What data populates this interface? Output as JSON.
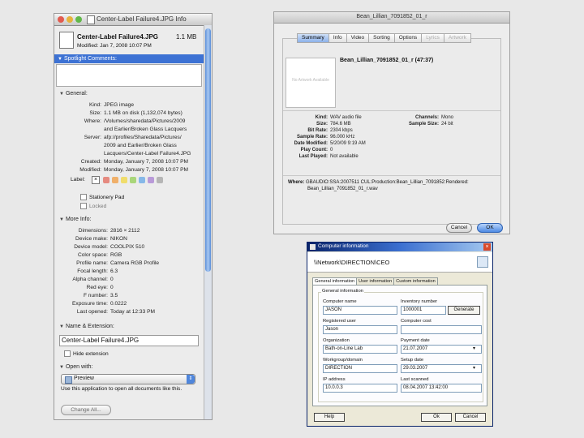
{
  "info_window": {
    "title": "Center-Label Failure4.JPG Info",
    "file_name": "Center-Label Failure4.JPG",
    "file_size": "1.1 MB",
    "modified_line": "Modified: Jan 7, 2008 10:07 PM",
    "spotlight_label": "Spotlight Comments:",
    "general_label": "General:",
    "general": [
      {
        "k": "Kind:",
        "v": "JPEG image"
      },
      {
        "k": "Size:",
        "v": "1.1 MB on disk (1,132,074 bytes)"
      },
      {
        "k": "Where:",
        "v": "/Volumes/sharedata/Pictures/2009"
      },
      {
        "k": "",
        "v": "and Earlier/Broken Glass Lacquers"
      },
      {
        "k": "Server:",
        "v": "afp://profiles/Sharedata/Pictures/"
      },
      {
        "k": "",
        "v": "2009 and Earlier/Broken Glass"
      },
      {
        "k": "",
        "v": "Lacquers/Center-Label Failure4.JPG"
      },
      {
        "k": "Created:",
        "v": "Monday, January 7, 2008 10:07 PM"
      },
      {
        "k": "Modified:",
        "v": "Monday, January 7, 2008 10:07 PM"
      }
    ],
    "label_label": "Label:",
    "label_swatch_colors": [
      "#e58a80",
      "#f0b06a",
      "#f0dd6c",
      "#a9d67a",
      "#86b8e8",
      "#b99ad8",
      "#b5b5b5"
    ],
    "stationery_label": "Stationery Pad",
    "locked_label": "Locked",
    "more_info_label": "More Info:",
    "more_info": [
      {
        "k": "Dimensions:",
        "v": "2816 × 2112"
      },
      {
        "k": "Device make:",
        "v": "NIKON"
      },
      {
        "k": "Device model:",
        "v": "COOLPIX 510"
      },
      {
        "k": "Color space:",
        "v": "RGB"
      },
      {
        "k": "Profile name:",
        "v": "Camera RGB Profile"
      },
      {
        "k": "Focal length:",
        "v": "6.3"
      },
      {
        "k": "Alpha channel:",
        "v": "0"
      },
      {
        "k": "Red eye:",
        "v": "0"
      },
      {
        "k": "F number:",
        "v": "3.5"
      },
      {
        "k": "Exposure time:",
        "v": "0.0222"
      },
      {
        "k": "Last opened:",
        "v": "Today at 12:33 PM"
      }
    ],
    "name_ext_label": "Name & Extension:",
    "name_value": "Center-Label Failure4.JPG",
    "hide_ext_label": "Hide extension",
    "open_with_label": "Open with:",
    "open_with_app": "Preview",
    "open_with_note": "Use this application to open all documents like this.",
    "change_all_label": "Change All..."
  },
  "itunes": {
    "title": "Bean_Lillian_7091852_01_r",
    "tabs": [
      "Summary",
      "Info",
      "Video",
      "Sorting",
      "Options",
      "Lyrics",
      "Artwork"
    ],
    "artwork_placeholder": "No Artwork Available",
    "track_line": "Bean_Lillian_7091852_01_r (47:37)",
    "details_left": [
      {
        "k": "Kind:",
        "v": "WAV audio file"
      },
      {
        "k": "Size:",
        "v": "784.6 MB"
      },
      {
        "k": "Bit Rate:",
        "v": "2304 kbps"
      },
      {
        "k": "Sample Rate:",
        "v": "96.000 kHz"
      },
      {
        "k": "Date Modified:",
        "v": "5/20/09 9:19 AM"
      },
      {
        "k": "Play Count:",
        "v": "0"
      },
      {
        "k": "Last Played:",
        "v": "Not available"
      }
    ],
    "details_right": [
      {
        "k": "Channels:",
        "v": "Mono"
      },
      {
        "k": "Sample Size:",
        "v": "24 bit"
      }
    ],
    "where_label": "Where:",
    "where_line1": "GBAUDIO:SSA:2007511 CUL:Production:Bean_Lillian_7091852:Rendered:",
    "where_line2": "Bean_Lillian_7091852_01_r.wav",
    "cancel_label": "Cancel",
    "ok_label": "OK"
  },
  "computer_info": {
    "title": "Computer information",
    "path": "\\\\Network\\DIRECTION\\CEO",
    "tabs": [
      "General information",
      "User information",
      "Custom information"
    ],
    "group_label": "General information",
    "fields": [
      {
        "label": "Computer name",
        "value": "JASON"
      },
      {
        "label": "Inventory number",
        "value": "1000001"
      },
      {
        "label": "Registered user",
        "value": "Jason"
      },
      {
        "label": "Computer cost",
        "value": ""
      },
      {
        "label": "Organization",
        "value": "Bath-on-Line Lab"
      },
      {
        "label": "Payment date",
        "value": "21.07.2007"
      },
      {
        "label": "Workgroup/domain",
        "value": "DIRECTION"
      },
      {
        "label": "Setup date",
        "value": "29.03.2007"
      },
      {
        "label": "IP address",
        "value": "10.0.0.3"
      },
      {
        "label": "Last scanned",
        "value": "08.04.2007 13:42:00"
      }
    ],
    "generate_label": "Generate",
    "help_label": "Help",
    "ok_label": "Ok",
    "cancel_label": "Cancel"
  }
}
